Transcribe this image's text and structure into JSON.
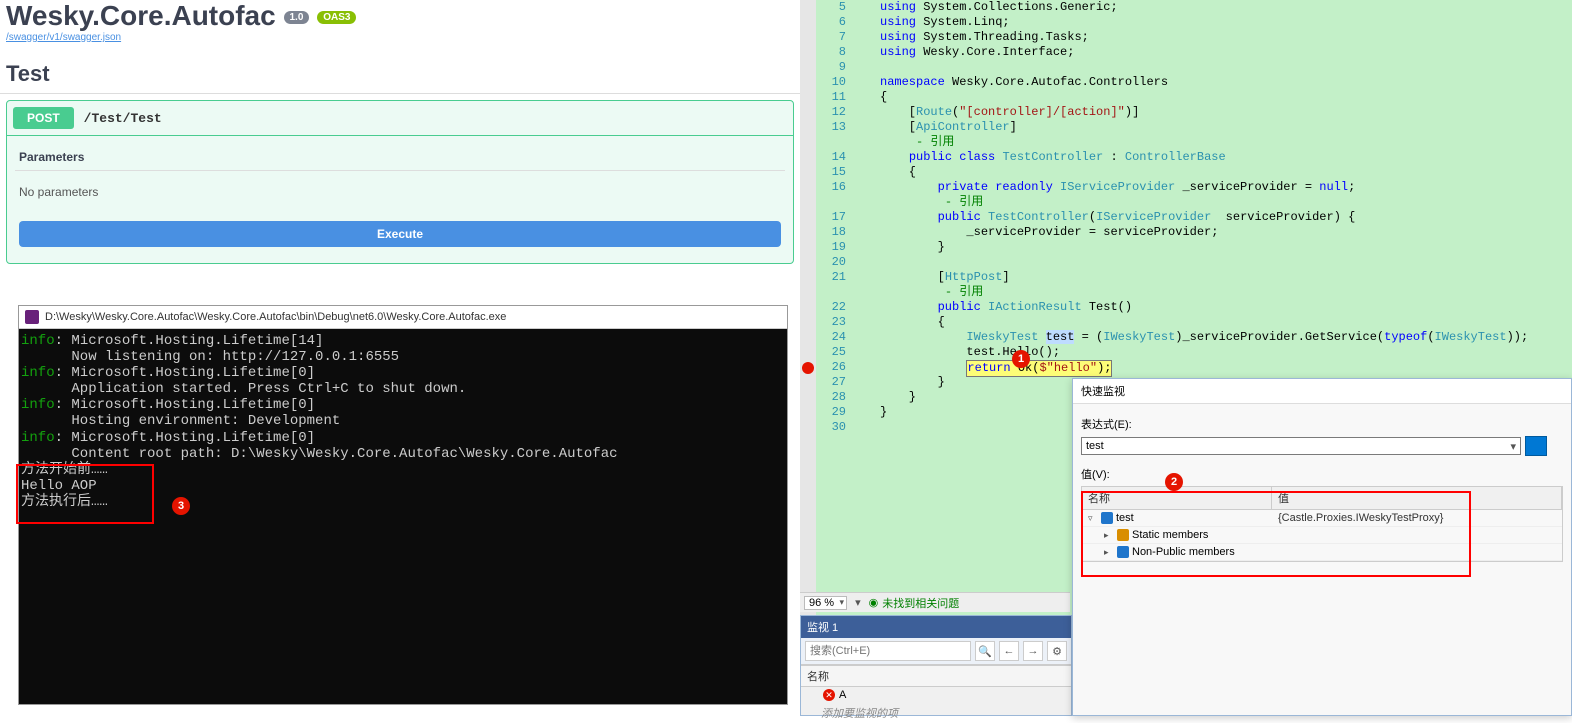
{
  "swagger": {
    "title": "Wesky.Core.Autofac",
    "link": "/swagger/v1/swagger.json",
    "section": "Test",
    "method": "POST",
    "path": "/Test/Test",
    "params_title": "Parameters",
    "no_params": "No parameters",
    "exec": "Execute"
  },
  "console": {
    "title": "D:\\Wesky\\Wesky.Core.Autofac\\Wesky.Core.Autofac\\bin\\Debug\\net6.0\\Wesky.Core.Autofac.exe",
    "lines": [
      {
        "pre": "info",
        "txt": ": Microsoft.Hosting.Lifetime[14]"
      },
      {
        "pre": "",
        "txt": "      Now listening on: http://127.0.0.1:6555"
      },
      {
        "pre": "info",
        "txt": ": Microsoft.Hosting.Lifetime[0]"
      },
      {
        "pre": "",
        "txt": "      Application started. Press Ctrl+C to shut down."
      },
      {
        "pre": "info",
        "txt": ": Microsoft.Hosting.Lifetime[0]"
      },
      {
        "pre": "",
        "txt": "      Hosting environment: Development"
      },
      {
        "pre": "info",
        "txt": ": Microsoft.Hosting.Lifetime[0]"
      },
      {
        "pre": "",
        "txt": "      Content root path: D:\\Wesky\\Wesky.Core.Autofac\\Wesky.Core.Autofac"
      },
      {
        "pre": "",
        "txt": "方法开始前……"
      },
      {
        "pre": "",
        "txt": "Hello AOP"
      },
      {
        "pre": "",
        "txt": "方法执行后……"
      }
    ]
  },
  "code": {
    "lines": [
      {
        "n": 5,
        "html": "<span class='kw'>using</span> System.Collections.Generic;"
      },
      {
        "n": 6,
        "html": "<span class='kw'>using</span> System.Linq;"
      },
      {
        "n": 7,
        "html": "<span class='kw'>using</span> System.Threading.Tasks;"
      },
      {
        "n": 8,
        "html": "<span class='kw'>using</span> Wesky.Core.Interface;"
      },
      {
        "n": 9,
        "html": ""
      },
      {
        "n": 10,
        "html": "<span class='kw'>namespace</span> Wesky.Core.Autofac.Controllers"
      },
      {
        "n": 11,
        "html": "{"
      },
      {
        "n": 12,
        "html": "    [<span class='type'>Route</span>(<span class='str'>\"[controller]/[action]\"</span>)]"
      },
      {
        "n": 13,
        "html": "    [<span class='type'>ApiController</span>]"
      },
      {
        "n": -1,
        "html": "     <span class='cmt'>- 引用</span>"
      },
      {
        "n": 14,
        "html": "    <span class='kw'>public class</span> <span class='type'>TestController</span> : <span class='type'>ControllerBase</span>"
      },
      {
        "n": 15,
        "html": "    {"
      },
      {
        "n": 16,
        "html": "        <span class='kw'>private readonly</span> <span class='type'>IServiceProvider</span> _serviceProvider = <span class='kw'>null</span>;"
      },
      {
        "n": -1,
        "html": "         <span class='cmt'>- 引用</span>"
      },
      {
        "n": 17,
        "html": "        <span class='kw'>public</span> <span class='type'>TestController</span>(<span class='type'>IServiceProvider</span>  serviceProvider) {"
      },
      {
        "n": 18,
        "html": "            _serviceProvider = serviceProvider;"
      },
      {
        "n": 19,
        "html": "        }"
      },
      {
        "n": 20,
        "html": ""
      },
      {
        "n": 21,
        "html": "        [<span class='type'>HttpPost</span>]"
      },
      {
        "n": -1,
        "html": "         <span class='cmt'>- 引用</span>"
      },
      {
        "n": 22,
        "html": "        <span class='kw'>public</span> <span class='type'>IActionResult</span> Test()"
      },
      {
        "n": 23,
        "html": "        {"
      },
      {
        "n": 24,
        "html": "            <span class='type'>IWeskyTest</span> <span style='background:#bedcff'>test</span> = (<span class='type'>IWeskyTest</span>)_serviceProvider.GetService(<span class='kw'>typeof</span>(<span class='type'>IWeskyTest</span>));"
      },
      {
        "n": 25,
        "html": "            test.Hello();"
      },
      {
        "n": 26,
        "html": "            <span class='curr-line'><span class='kw'>return</span> Ok(<span class='str'>$\"hello\"</span>);</span>",
        "bp": true
      },
      {
        "n": 27,
        "html": "        }"
      },
      {
        "n": 28,
        "html": "    }"
      },
      {
        "n": 29,
        "html": "}"
      },
      {
        "n": 30,
        "html": ""
      }
    ]
  },
  "zoom": {
    "pct": "96 %",
    "status": "未找到相关问题"
  },
  "watch": {
    "title": "监视 1",
    "search_ph": "搜索(Ctrl+E)",
    "col_name": "名称",
    "row_err": "A",
    "hint": "添加要监视的项"
  },
  "qw": {
    "title": "快速监视",
    "expr_label": "表达式(E):",
    "expr_value": "test",
    "val_label": "值(V):",
    "col_name": "名称",
    "col_val": "值",
    "rows": [
      {
        "indent": 0,
        "arrow": "▿",
        "icon": "obj",
        "name": "test",
        "val": "{Castle.Proxies.IWeskyTestProxy}"
      },
      {
        "indent": 1,
        "arrow": "▸",
        "icon": "key",
        "name": "Static members",
        "val": ""
      },
      {
        "indent": 1,
        "arrow": "▸",
        "icon": "obj",
        "name": "Non-Public members",
        "val": ""
      }
    ]
  },
  "badges": {
    "b1": "1",
    "b2": "2",
    "b3": "3"
  }
}
